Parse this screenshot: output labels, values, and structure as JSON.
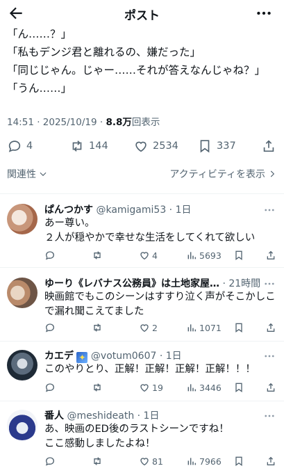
{
  "header": {
    "title": "ポスト",
    "back_icon": "arrow-left-icon",
    "more_icon": "more-horizontal-icon"
  },
  "post": {
    "lines": [
      "「ん……？」",
      "「私もデンジ君と離れるの、嫌だった」",
      "「同じじゃん。じゃー……それが答えなんじゃね？」",
      "「うん……」"
    ],
    "time": "14:51 · 2025/10/19 · ",
    "views": "8.8万",
    "views_suffix": "回表示",
    "stats": {
      "replies": "4",
      "reposts": "144",
      "likes": "2534",
      "bookmarks": "337"
    }
  },
  "filters": {
    "relevance": "関連性",
    "activity": "アクティビティを表示"
  },
  "replies": [
    {
      "name": "ぱんつかす",
      "handle": "@kamigami53 · 1日",
      "lines": [
        "あー尊い。",
        "２人が穏やかで幸せな生活をしてくれて欲しい"
      ],
      "replies": "",
      "reposts": "",
      "likes": "4",
      "views": "5693"
    },
    {
      "name": "ゆーり《レバナス公務員》は土地家屋…",
      "handle": "· 21時間",
      "lines": [
        "映画館でもこのシーンはすすり泣く声がそこかしこ",
        "で漏れ聞こえてました"
      ],
      "replies": "",
      "reposts": "",
      "likes": "2",
      "views": "1071"
    },
    {
      "name": "カエデ",
      "handle": "@votum0607 · 1日",
      "lines": [
        "このやりとり、正解！正解！正解！正解！！！"
      ],
      "replies": "",
      "reposts": "",
      "likes": "19",
      "views": "3446"
    },
    {
      "name": "番人",
      "handle": "@meshideath · 1日",
      "lines": [
        "あ、映画のED後のラストシーンですね！",
        "ここ感動しましたよね！"
      ],
      "replies": "",
      "reposts": "",
      "likes": "81",
      "views": "7966"
    }
  ],
  "colors": {
    "text": "#0f1419",
    "muted": "#536471",
    "divider": "#eff3f4"
  }
}
